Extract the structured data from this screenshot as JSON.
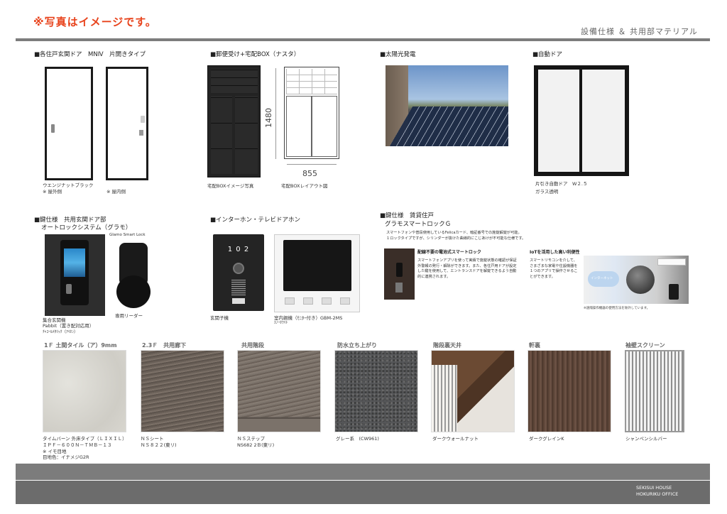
{
  "header": {
    "notice": "※写真はイメージです。",
    "title": "設備仕様 ＆ 共用部マテリアル"
  },
  "sections": {
    "entrance_door": {
      "heading": "■各住戸玄関ドア　MNⅣ　片開きタイプ",
      "cap_color": "ウエンジナットブラック",
      "cap_outside": "※ 屋外側",
      "cap_inside": "※ 屋内側"
    },
    "mailbox": {
      "heading": "■郵便受け+宅配BOX（ナスタ）",
      "height_dim": "1480",
      "width_dim": "855",
      "cap_photo": "宅配BOXイメージ写真",
      "cap_layout": "宅配BOXレイアウト図"
    },
    "solar": {
      "heading": "■太陽光発電"
    },
    "auto_door": {
      "heading": "■自動ドア",
      "cap1": "片引き自動ドア　W２.５",
      "cap2": "ガラス透明"
    },
    "autolock": {
      "heading1": "■鍵仕様　共用玄関ドア部",
      "heading2": "オートロックシステム（グラモ）",
      "smartlock_label": "Glamo Smart Lock",
      "cap1": "集合玄関機",
      "cap2": "Pabbit（置き配対応用）",
      "cap3": "ﾁｬｺｰﾙﾒﾀﾘｯｸ（ｱｲﾎﾝ）",
      "reader_label": "専用リーダー"
    },
    "intercom": {
      "heading": "■インターホン・テレビドアホン",
      "door_number": "1 0 2",
      "cap_entrance": "玄関子機",
      "cap_monitor1": "室内親機（ﾓﾆﾀｰ付き）GBM-2MS",
      "cap_monitor2": "ｽﾉｰﾎﾜｲﾄ"
    },
    "smart_lock": {
      "heading1": "■鍵仕様　賃貸住戸",
      "heading2": "グラモスマートロックＧ",
      "desc1": "スマートフォンや普段使用しているFelicaカード、暗証番号での施錠解錠が可能。",
      "desc2": "１ロックタイプですが、シリンダーが抜けた曲線的にこじあけが不可能な仕様です。",
      "box1_title": "配線不要の電池式スマートロック",
      "box1_text": "スマートフォンアプリを使って実績で施錠状態の確認が保証外警報の発行・解除ができます。また、各住戸用ドアが設定した鍵を使用して、エントランスドアを解錠できるよう自動的に連携されます。",
      "box2_title": "IoTを活用した高い利便性",
      "box2_text": "スマートリモコンを介して、さまざまな家電や住設機器を１つのアプリで操作させることができます。",
      "internet_label": "インターネット",
      "note": "※遠隔操作機器の使用方法を除外しています。"
    }
  },
  "materials": [
    {
      "label": "1Ｆ 土間タイル（ア）9mm",
      "caption": [
        "タイムバーン 外床タイプ（ＬＩＸＩＬ）",
        "ＩＰＦ－６００Ｎ－ＴＭＢ－１３",
        "※ イモ目地",
        "目地色：イナメジG2R"
      ]
    },
    {
      "label": "2.3Ｆ　共用廊下",
      "caption": [
        "ＮＳシート",
        "ＮＳ８２２(東リ)"
      ]
    },
    {
      "label": "共用階段",
      "caption": [
        "ＮＳステップ",
        "NS682 2Ｂ(東リ)"
      ]
    },
    {
      "label": "防水立ち上がり",
      "caption": [
        "グレー系　(CW961)"
      ]
    },
    {
      "label": "階段裏天井",
      "caption": [
        "ダークウォールナット"
      ]
    },
    {
      "label": "軒裏",
      "caption": [
        "ダークグレインK"
      ]
    },
    {
      "label": "袖壁スクリーン",
      "caption": [
        "シャンペンシルバー"
      ]
    }
  ],
  "footer": {
    "company1": "SEKISUI HOUSE",
    "company2": "HOKURIKU OFFICE"
  },
  "colors": {
    "notice": "#e8431c",
    "bar": "#7d7d7d",
    "door": "#2e2826"
  }
}
